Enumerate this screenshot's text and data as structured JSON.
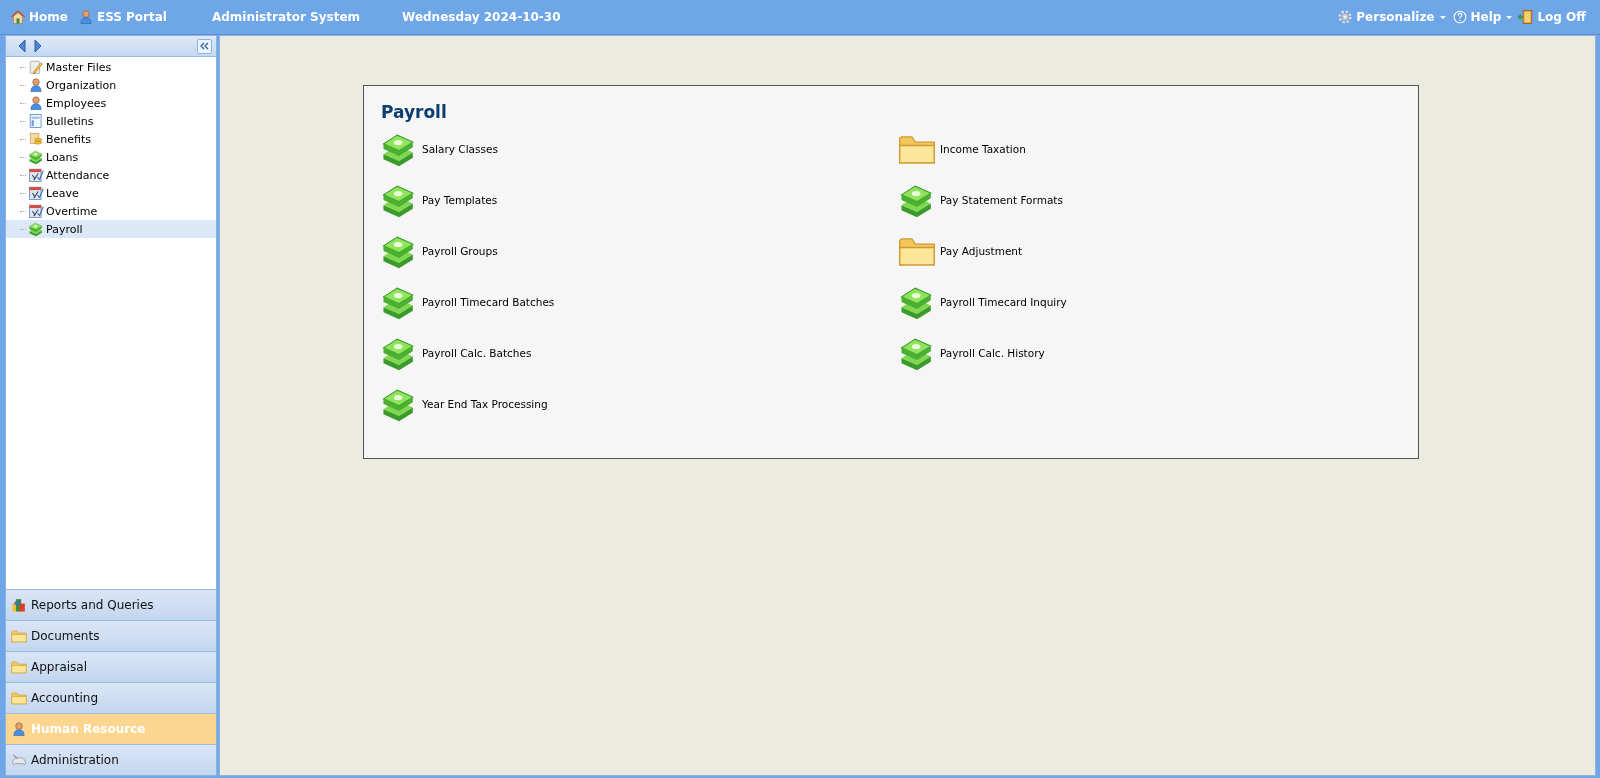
{
  "top_bar": {
    "links": [
      {
        "label": "Home",
        "kind": "home"
      },
      {
        "label": "ESS Portal",
        "kind": "person"
      }
    ],
    "system": "Administrator System",
    "date": "Wednesday 2024-10-30",
    "right_links": [
      {
        "label": "Personalize",
        "kind": "gear",
        "dropdown": true
      },
      {
        "label": "Help",
        "kind": "help",
        "dropdown": true
      },
      {
        "label": "Log Off",
        "kind": "door",
        "dropdown": false
      }
    ]
  },
  "tree": {
    "items": [
      {
        "label": "Master Files",
        "kind": "pencil",
        "selected": false
      },
      {
        "label": "Organization",
        "kind": "person",
        "selected": false
      },
      {
        "label": "Employees",
        "kind": "person",
        "selected": false
      },
      {
        "label": "Bulletins",
        "kind": "bulletin",
        "selected": false
      },
      {
        "label": "Benefits",
        "kind": "coins",
        "selected": false
      },
      {
        "label": "Loans",
        "kind": "money",
        "selected": false
      },
      {
        "label": "Attendance",
        "kind": "calendar",
        "selected": false
      },
      {
        "label": "Leave",
        "kind": "calendar",
        "selected": false
      },
      {
        "label": "Overtime",
        "kind": "calendar",
        "selected": false
      },
      {
        "label": "Payroll",
        "kind": "money",
        "selected": true
      }
    ]
  },
  "modules": [
    {
      "label": "Reports and Queries",
      "kind": "reports",
      "selected": false
    },
    {
      "label": "Documents",
      "kind": "folder",
      "selected": false
    },
    {
      "label": "Appraisal",
      "kind": "folder",
      "selected": false
    },
    {
      "label": "Accounting",
      "kind": "folder",
      "selected": false
    },
    {
      "label": "Human Resource",
      "kind": "person",
      "selected": true
    },
    {
      "label": "Administration",
      "kind": "gamepad",
      "selected": false
    }
  ],
  "panel": {
    "title": "Payroll",
    "items": [
      {
        "label": "Salary Classes",
        "kind": "money"
      },
      {
        "label": "Income Taxation",
        "kind": "folder"
      },
      {
        "label": "Pay Templates",
        "kind": "money"
      },
      {
        "label": "Pay Statement Formats",
        "kind": "money"
      },
      {
        "label": "Payroll Groups",
        "kind": "money"
      },
      {
        "label": "Pay Adjustment",
        "kind": "folder"
      },
      {
        "label": "Payroll Timecard Batches",
        "kind": "money"
      },
      {
        "label": "Payroll Timecard Inquiry",
        "kind": "money"
      },
      {
        "label": "Payroll Calc. Batches",
        "kind": "money"
      },
      {
        "label": "Payroll Calc. History",
        "kind": "money"
      },
      {
        "label": "Year End Tax Processing",
        "kind": "money"
      }
    ]
  }
}
